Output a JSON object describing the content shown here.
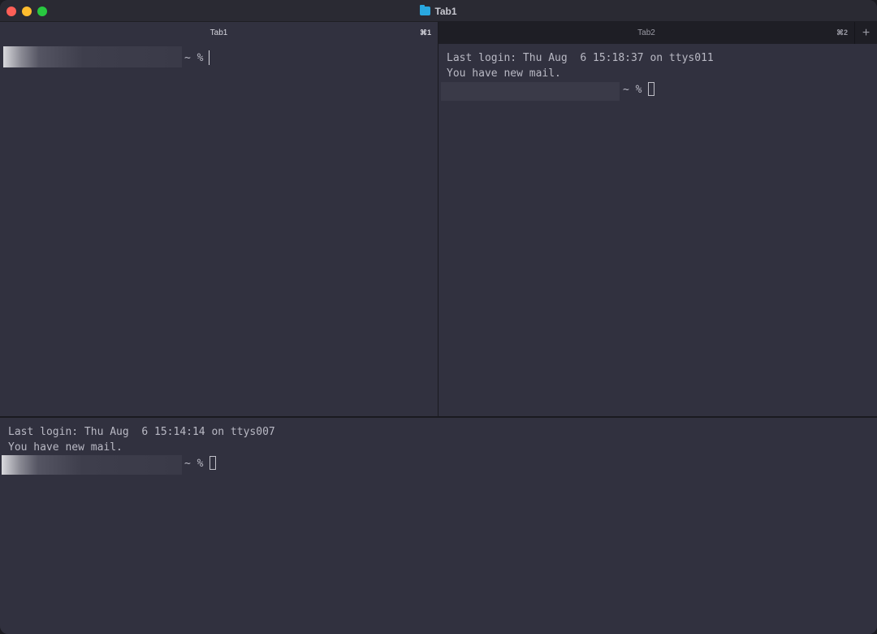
{
  "window": {
    "title": "Tab1",
    "title_icon": "folder-icon"
  },
  "tabs": [
    {
      "label": "Tab1",
      "shortcut": "⌘1",
      "active": true
    },
    {
      "label": "Tab2",
      "shortcut": "⌘2",
      "active": false
    }
  ],
  "new_tab_label": "+",
  "panes": {
    "top_left": {
      "prompt": "~ %"
    },
    "top_right": {
      "lines": [
        "Last login: Thu Aug  6 15:18:37 on ttys011",
        "You have new mail."
      ],
      "prompt": "~ %"
    },
    "bottom": {
      "lines": [
        "Last login: Thu Aug  6 15:14:14 on ttys007",
        "You have new mail."
      ],
      "prompt": "~ %"
    }
  },
  "colors": {
    "background": "#31313f",
    "text": "#b9b9c4",
    "close": "#fe5f57",
    "minimize": "#febc2e",
    "maximize": "#28c840",
    "folder_icon": "#29a8e0"
  }
}
